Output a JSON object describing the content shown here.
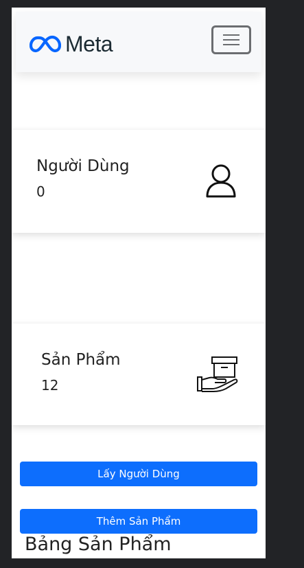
{
  "navbar": {
    "brand": "Meta",
    "brand_color": "#0866ff",
    "menu_icon": "hamburger-icon"
  },
  "cards": {
    "users": {
      "label": "Người Dùng",
      "value": "0",
      "icon": "user-icon"
    },
    "products": {
      "label": "Sản Phẩm",
      "value": "12",
      "icon": "hand-box-icon"
    }
  },
  "buttons": {
    "get_users": "Lấy Người Dùng",
    "add_product": "Thêm Sản Phẩm",
    "color": "#0d6efd"
  },
  "table": {
    "title": "Bảng Sản Phẩm"
  }
}
